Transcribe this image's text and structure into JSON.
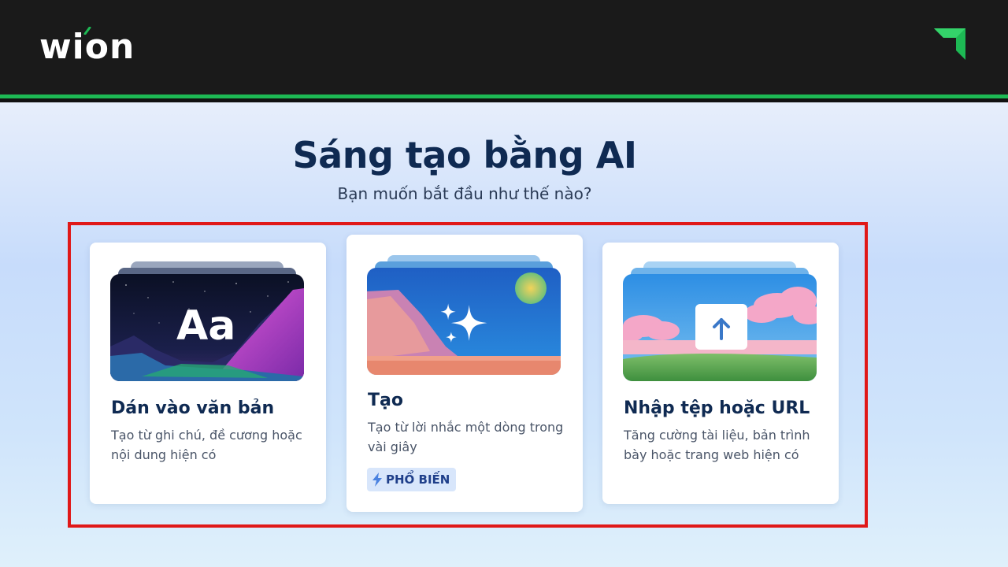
{
  "header": {
    "brand": "wion",
    "colors": {
      "bar": "#1a1a1a",
      "accent": "#1db954"
    },
    "corner_icon": "green-arrow-logo-icon"
  },
  "main": {
    "title": "Sáng tạo bằng AI",
    "subtitle": "Bạn muốn bắt đầu như thế nào?"
  },
  "cards": [
    {
      "title": "Dán vào văn bản",
      "description": "Tạo từ ghi chú, đề cương hoặc nội dung hiện có",
      "thumbnail_text": "Aa",
      "thumbnail_icon": "text-aa-icon"
    },
    {
      "title": "Tạo",
      "description": "Tạo từ lời nhắc một dòng trong vài giây",
      "badge": "PHỔ BIẾN",
      "badge_icon": "lightning-icon",
      "thumbnail_icon": "sparkles-icon"
    },
    {
      "title": "Nhập tệp hoặc URL",
      "description": "Tăng cường tài liệu, bản trình bày hoặc trang web hiện có",
      "thumbnail_icon": "folder-upload-icon"
    }
  ],
  "highlight_color": "#e01818"
}
